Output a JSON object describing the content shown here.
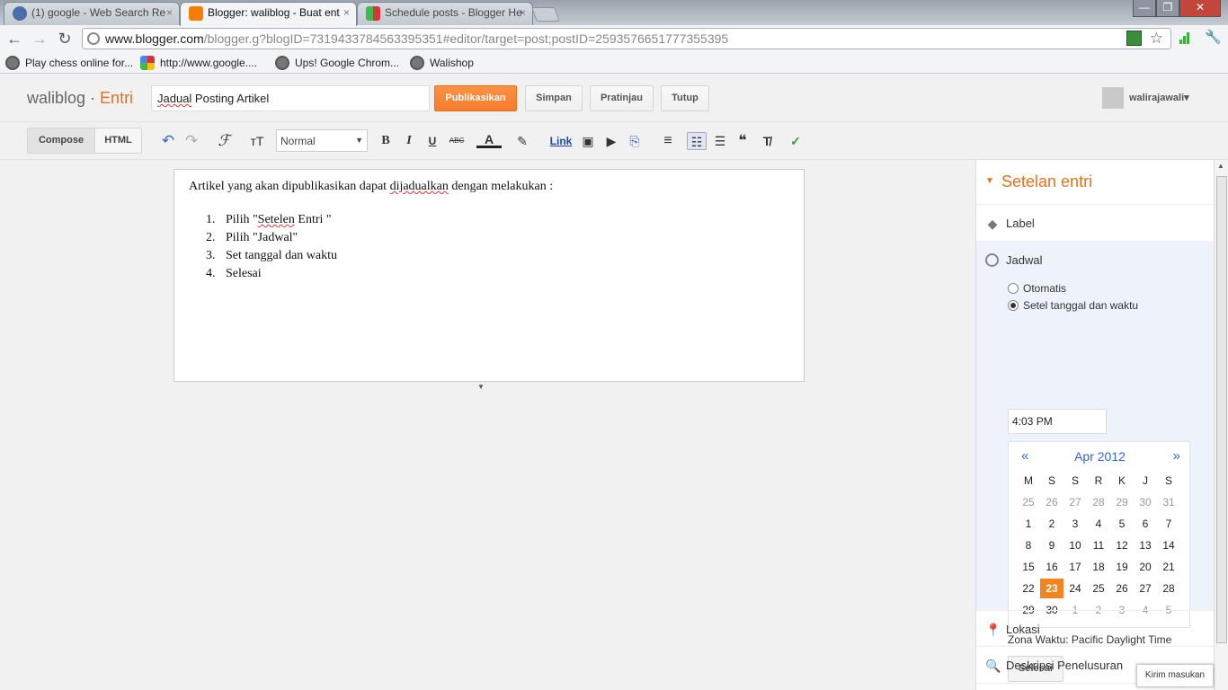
{
  "browser": {
    "tabs": [
      {
        "title": "(1) google - Web Search Re",
        "close": "×",
        "favicon_color": "#4a6ea8"
      },
      {
        "title": "Blogger: waliblog - Buat ent",
        "close": "×",
        "favicon_color": "#f57d00"
      },
      {
        "title": "Schedule posts - Blogger He",
        "close": "×",
        "favicon_color": "#3cba54"
      }
    ],
    "window_buttons": {
      "minimize": "—",
      "maximize": "❐",
      "close": "✕"
    },
    "back_icon": "←",
    "forward_icon": "→",
    "reload_icon": "↻",
    "url_domain": "www.blogger.com",
    "url_path": "/blogger.g?blogID=7319433784563395351#editor/target=post;postID=2593576651777355395",
    "star_icon": "☆",
    "wrench_icon": "🔧"
  },
  "bookmarks": [
    {
      "label": "Play chess online for..."
    },
    {
      "label": "http://www.google...."
    },
    {
      "label": "Ups! Google Chrom..."
    },
    {
      "label": "Walishop"
    }
  ],
  "blog": {
    "name": "waliblog",
    "separator": " · ",
    "section": "Entri",
    "post_title": "Jadual Posting Artikel",
    "post_title_word1": "Jadual",
    "post_title_rest": " Posting Artikel",
    "buttons": {
      "publish": "Publikasikan",
      "save": "Simpan",
      "preview": "Pratinjau",
      "close": "Tutup"
    },
    "user": "walirajawali▾"
  },
  "toolbar": {
    "compose": "Compose",
    "html": "HTML",
    "font": "Normal",
    "link": "Link",
    "icons": {
      "undo": "↶",
      "redo": "↷",
      "font_family": "ℱ",
      "font_size": "тT",
      "bold": "B",
      "italic": "I",
      "underline": "U",
      "strike": "ABC",
      "text_color": "A",
      "highlight": "✎",
      "image": "▣",
      "video": "▶",
      "jump": "⎘",
      "align": "≡",
      "numbered": "☷",
      "bulleted": "☰",
      "quote": "❝",
      "clear": "T̸",
      "spell": "✓"
    }
  },
  "editor": {
    "intro_pre": "Artikel yang akan dipublikasikan dapat ",
    "intro_squig": "dijadualkan",
    "intro_post": " dengan melakukan :",
    "items": [
      {
        "n": "1.",
        "pre": "Pilih \"",
        "squig": "Setelen",
        "post": " Entri \""
      },
      {
        "n": "2.",
        "pre": "Pilih \"Jadwal\"",
        "squig": "",
        "post": ""
      },
      {
        "n": "3.",
        "pre": "Set tanggal dan waktu",
        "squig": "",
        "post": ""
      },
      {
        "n": "4.",
        "pre": "Selesai",
        "squig": "",
        "post": ""
      }
    ]
  },
  "sidebar": {
    "heading": "Setelan entri",
    "label": "Label",
    "jadwal": "Jadwal",
    "radio_auto": "Otomatis",
    "radio_set": "Setel tanggal dan waktu",
    "radio_selected": "set",
    "time": "4:03 PM",
    "calendar": {
      "prev": "«",
      "next": "»",
      "month": "Apr 2012",
      "dow": [
        "M",
        "S",
        "S",
        "R",
        "K",
        "J",
        "S"
      ],
      "weeks": [
        [
          "25",
          "26",
          "27",
          "28",
          "29",
          "30",
          "31"
        ],
        [
          "1",
          "2",
          "3",
          "4",
          "5",
          "6",
          "7"
        ],
        [
          "8",
          "9",
          "10",
          "11",
          "12",
          "13",
          "14"
        ],
        [
          "15",
          "16",
          "17",
          "18",
          "19",
          "20",
          "21"
        ],
        [
          "22",
          "23",
          "24",
          "25",
          "26",
          "27",
          "28"
        ],
        [
          "29",
          "30",
          "1",
          "2",
          "3",
          "4",
          "5"
        ]
      ],
      "selected": "23"
    },
    "timezone": "Zona Waktu: Pacific Daylight Time",
    "done": "Selesai",
    "lokasi": "Lokasi",
    "deskripsi": "Deskripsi Penelusuran"
  },
  "feedback": "Kirim masukan",
  "colors": {
    "accent": "#f57c2f",
    "link": "#3366cc"
  }
}
